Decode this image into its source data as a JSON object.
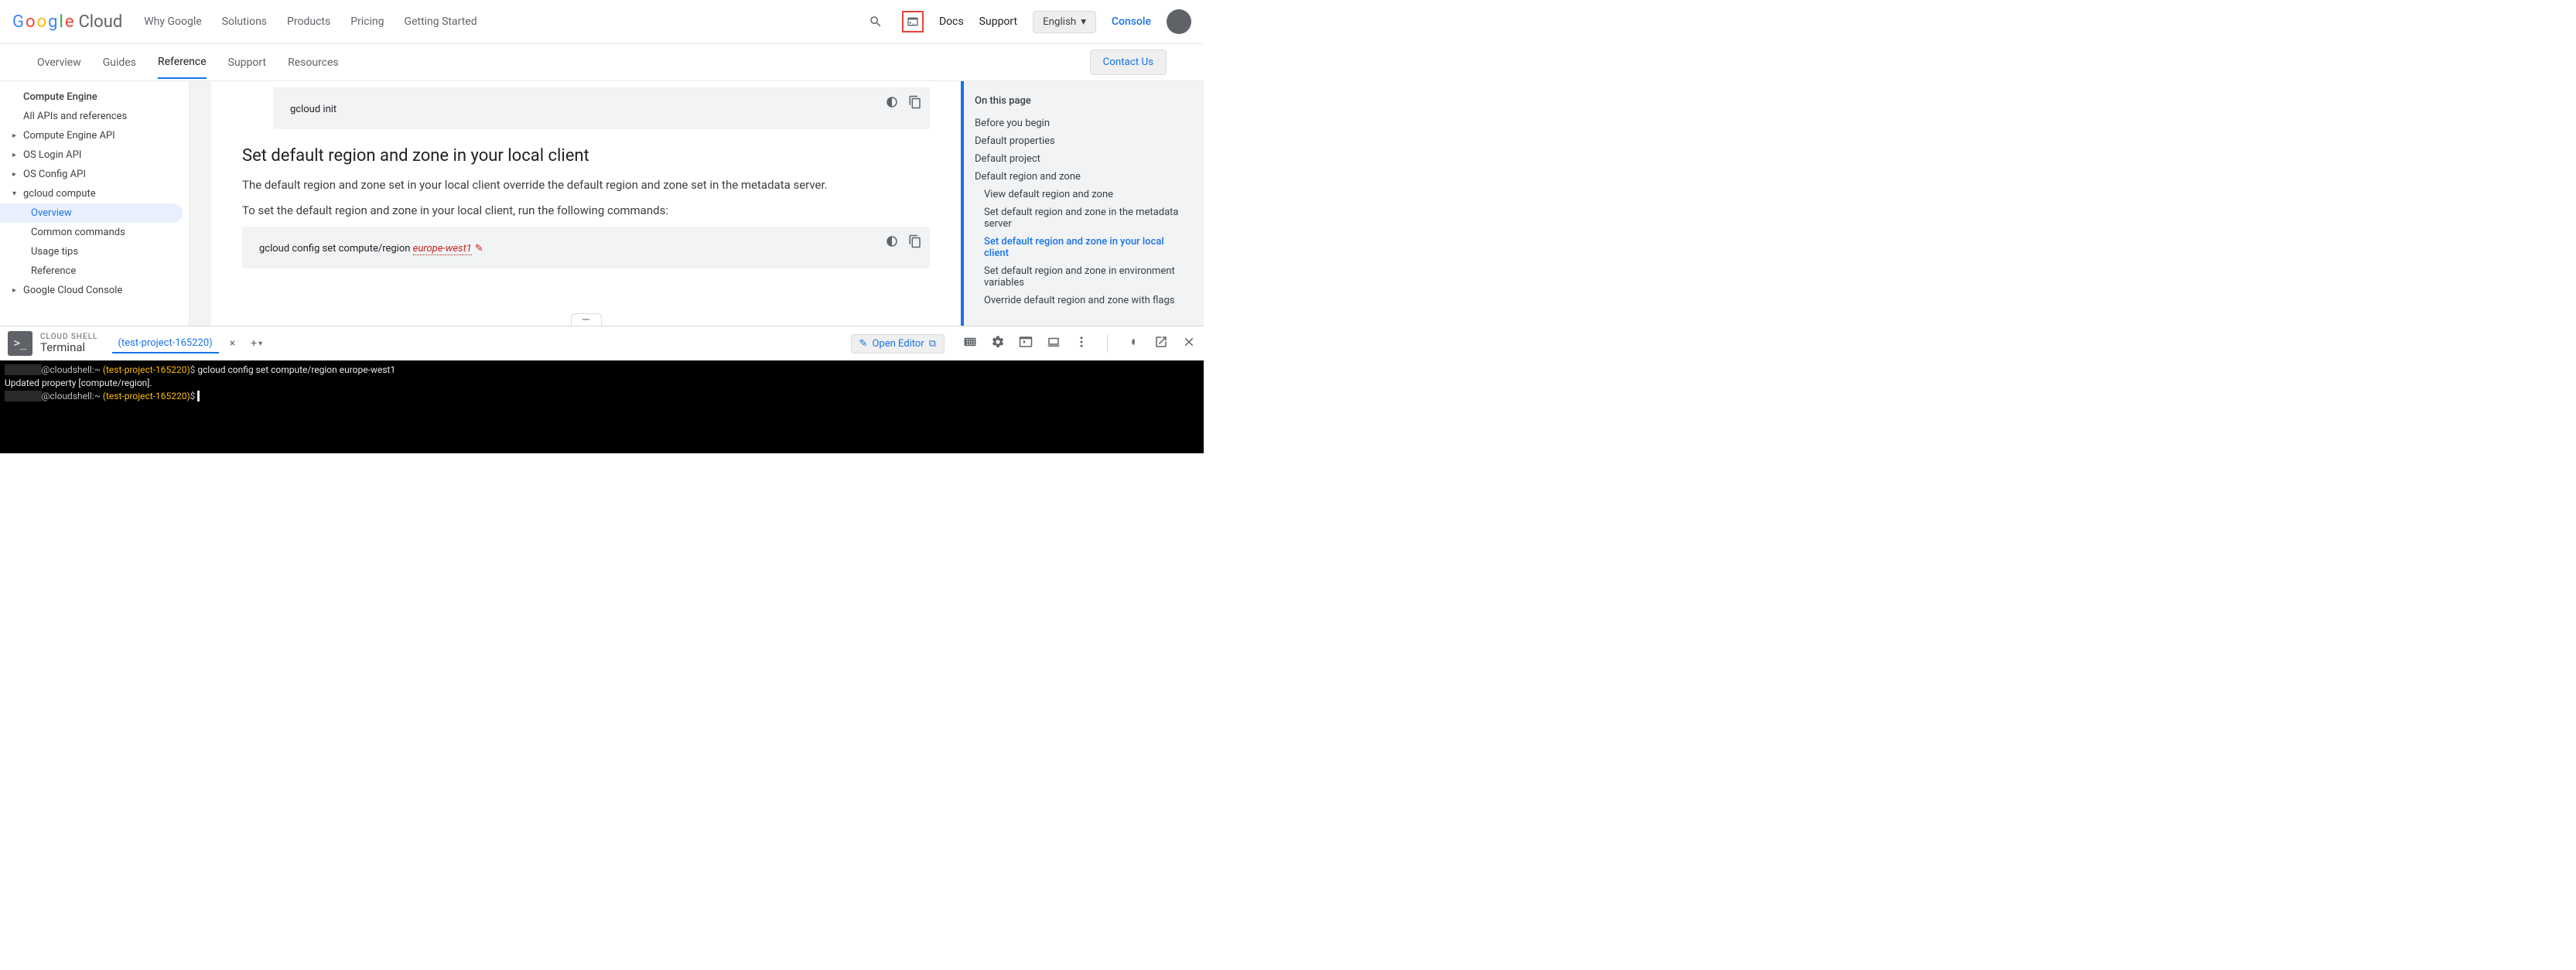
{
  "header": {
    "logo_cloud": "Cloud",
    "nav": [
      "Why Google",
      "Solutions",
      "Products",
      "Pricing",
      "Getting Started"
    ],
    "docs": "Docs",
    "support": "Support",
    "language": "English",
    "console": "Console"
  },
  "subtabs": {
    "items": [
      "Overview",
      "Guides",
      "Reference",
      "Support",
      "Resources"
    ],
    "active_index": 2,
    "contact": "Contact Us"
  },
  "sidebar": {
    "items": [
      {
        "label": "Compute Engine",
        "bold": true,
        "indent": 0
      },
      {
        "label": "All APIs and references",
        "indent": 0
      },
      {
        "label": "Compute Engine API",
        "indent": 0,
        "caret": "▸"
      },
      {
        "label": "OS Login API",
        "indent": 0,
        "caret": "▸"
      },
      {
        "label": "OS Config API",
        "indent": 0,
        "caret": "▸"
      },
      {
        "label": "gcloud compute",
        "indent": 0,
        "caret": "▾"
      },
      {
        "label": "Overview",
        "indent": 2,
        "selected": true
      },
      {
        "label": "Common commands",
        "indent": 2
      },
      {
        "label": "Usage tips",
        "indent": 2
      },
      {
        "label": "Reference",
        "indent": 2
      },
      {
        "label": "Google Cloud Console",
        "indent": 0,
        "caret": "▸"
      }
    ]
  },
  "article": {
    "code1": "gcloud init",
    "h2": "Set default region and zone in your local client",
    "p1": "The default region and zone set in your local client override the default region and zone set in the metadata server.",
    "p2": "To set the default region and zone in your local client, run the following commands:",
    "code2_prefix": "gcloud config set compute/region ",
    "code2_var": "europe-west1"
  },
  "rightnav": {
    "title": "On this page",
    "items": [
      {
        "label": "Before you begin",
        "sub": false
      },
      {
        "label": "Default properties",
        "sub": false
      },
      {
        "label": "Default project",
        "sub": false
      },
      {
        "label": "Default region and zone",
        "sub": false
      },
      {
        "label": "View default region and zone",
        "sub": true
      },
      {
        "label": "Set default region and zone in the metadata server",
        "sub": true
      },
      {
        "label": "Set default region and zone in your local client",
        "sub": true,
        "active": true
      },
      {
        "label": "Set default region and zone in environment variables",
        "sub": true
      },
      {
        "label": "Override default region and zone with flags",
        "sub": true
      }
    ]
  },
  "shell": {
    "label": "CLOUD SHELL",
    "terminal_title": "Terminal",
    "tab": "(test-project-165220)",
    "open_editor": "Open Editor",
    "lines": {
      "l1_host": "@cloudshell:~ ",
      "l1_proj": "(test-project-165220)",
      "l1_dollar": "$ ",
      "l1_cmd": "gcloud config set compute/region europe-west1",
      "l2": "Updated property [compute/region].",
      "l3_host": "@cloudshell:~ ",
      "l3_proj": "(test-project-165220)",
      "l3_dollar": "$ "
    }
  }
}
